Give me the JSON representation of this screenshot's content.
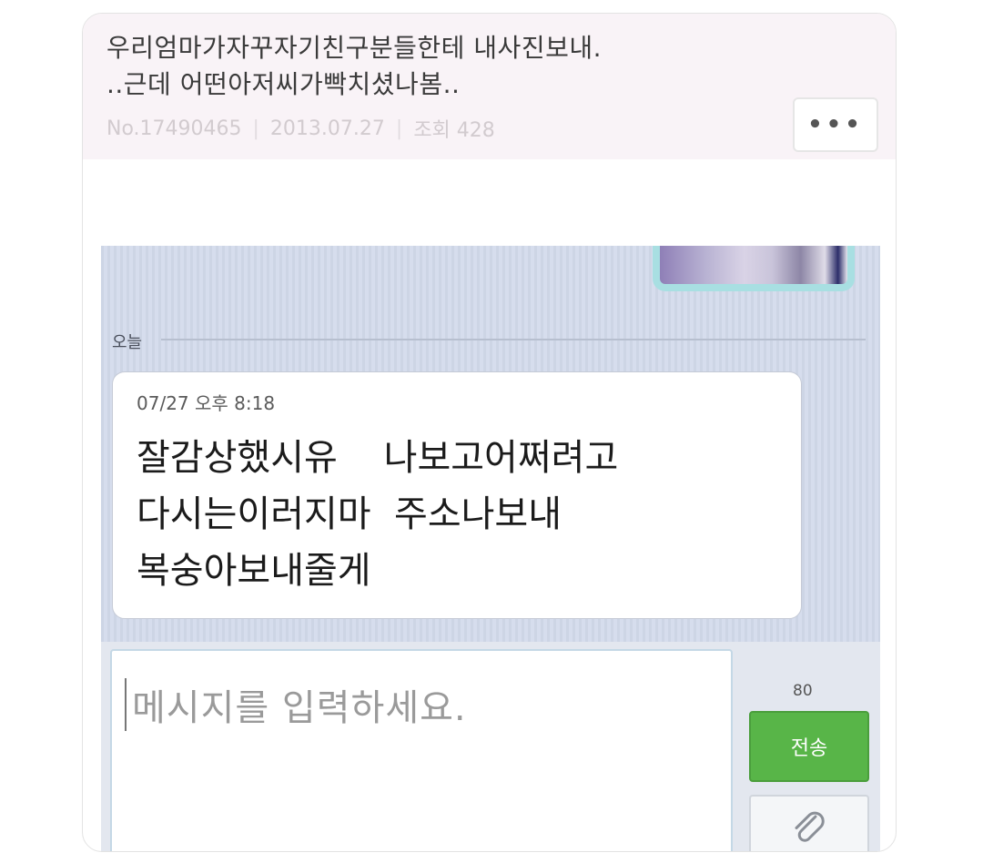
{
  "post": {
    "title_line1": "우리엄마가자꾸자기친구분들한테 내사진보내.",
    "title_line2": "..근데 어떤아저씨가빡치셨나봄..",
    "meta": {
      "number": "No.17490465",
      "date": "2013.07.27",
      "views": "조회 428"
    },
    "more_label": "•••"
  },
  "chat": {
    "day_label": "오늘",
    "message": {
      "time": "07/27 오후 8:18",
      "line1": "잘감상했시유    나보고어쩌려고",
      "line2": "다시는이러지마  주소나보내",
      "line3": "복숭아보내줄게"
    }
  },
  "composer": {
    "placeholder": "메시지를 입력하세요.",
    "char_count": "80",
    "send_label": "전송"
  },
  "icons": [
    "more-icon",
    "paperclip-icon"
  ],
  "colors": {
    "send_green": "#58b548",
    "chat_bg": "#d2d9ea",
    "input_border": "#c4d8e6"
  }
}
